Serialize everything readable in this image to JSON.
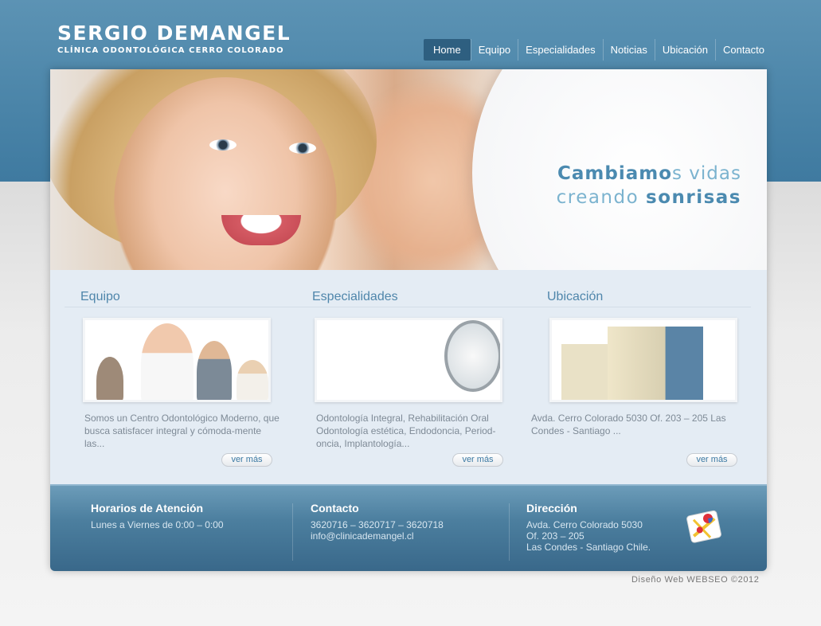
{
  "header": {
    "logo_name": "SERGIO DEMANGEL",
    "logo_sub": "CLÍNICA ODONTOLÓGICA CERRO COLORADO"
  },
  "nav": {
    "items": [
      "Home",
      "Equipo",
      "Especialidades",
      "Noticias",
      "Ubicación",
      "Contacto"
    ],
    "active": "Home"
  },
  "hero": {
    "line1_a": "Cambiamo",
    "line1_b": "s vidas",
    "line2_a": "creando ",
    "line2_b": "sonrisas"
  },
  "columns": [
    {
      "title": "Equipo",
      "desc": "Somos un Centro Odontológico Moderno, que busca satisfacer integral y cómoda-mente las...",
      "more": "ver más"
    },
    {
      "title": "Especialidades",
      "desc": "Odontología Integral, Rehabilitación Oral Odontología estética, Endodoncia, Period-oncia, Implantología...",
      "more": "ver más"
    },
    {
      "title": "Ubicación",
      "desc": "Avda. Cerro Colorado 5030 Of. 203 – 205 Las Condes - Santiago ...",
      "more": "ver más"
    }
  ],
  "footer": {
    "hours_title": "Horarios de Atención",
    "hours_text": "Lunes a Viernes de 0:00 – 0:00",
    "contact_title": "Contacto",
    "contact_phones": "3620716 – 3620717 – 3620718",
    "contact_email": "info@clinicademangel.cl",
    "address_title": "Dirección",
    "address_line1": "Avda. Cerro Colorado 5030",
    "address_line2": "Of. 203 – 205",
    "address_line3": "Las Condes - Santiago Chile."
  },
  "credit": "Diseño Web WEBSEO ©2012",
  "colors": {
    "header_blue": "#4a84a8",
    "accent": "#4f86ab",
    "nav_active": "#2e5f80"
  }
}
